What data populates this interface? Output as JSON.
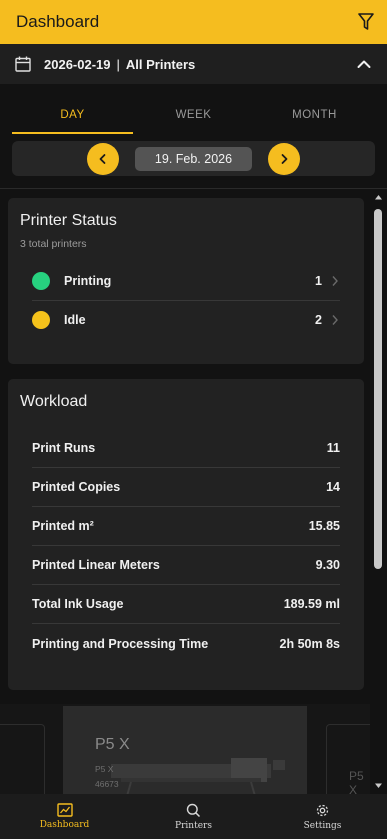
{
  "colors": {
    "accent": "#f5bd1f",
    "printing": "#27d17f",
    "idle": "#f5c21b",
    "background": "#121212",
    "card": "#222222"
  },
  "appbar": {
    "title": "Dashboard",
    "filter_icon": "filter-icon"
  },
  "context": {
    "calendar_icon": "calendar-icon",
    "date": "2026-02-19",
    "separator": "|",
    "printers": "All Printers",
    "collapse_icon": "chevron-up-icon"
  },
  "tabs": [
    {
      "label": "DAY",
      "active": true
    },
    {
      "label": "WEEK",
      "active": false
    },
    {
      "label": "MONTH",
      "active": false
    }
  ],
  "date_nav": {
    "prev_icon": "chevron-left-icon",
    "current": "19. Feb. 2026",
    "next_icon": "chevron-right-icon"
  },
  "printer_status": {
    "title": "Printer Status",
    "subtitle_count": "3",
    "subtitle_text": "total printers",
    "rows": [
      {
        "label": "Printing",
        "count": "1"
      },
      {
        "label": "Idle",
        "count": "2"
      }
    ]
  },
  "workload": {
    "title": "Workload",
    "rows": [
      {
        "label": "Print Runs",
        "value": "11"
      },
      {
        "label": "Printed Copies",
        "value": "14"
      },
      {
        "label": "Printed m²",
        "value": "15.85"
      },
      {
        "label": "Printed Linear Meters",
        "value": "9.30"
      },
      {
        "label": "Total Ink Usage",
        "value": "189.59 ml"
      },
      {
        "label": "Printing and Processing Time",
        "value": "2h 50m 8s"
      }
    ]
  },
  "printer_carousel": {
    "current": {
      "name": "P5 X",
      "model": "P5 X",
      "serial": "46673"
    },
    "next_name": "P5 X"
  },
  "bottom_nav": [
    {
      "label": "Dashboard",
      "icon": "dashboard-icon",
      "active": true
    },
    {
      "label": "Printers",
      "icon": "search-icon",
      "active": false
    },
    {
      "label": "Settings",
      "icon": "gear-icon",
      "active": false
    }
  ]
}
